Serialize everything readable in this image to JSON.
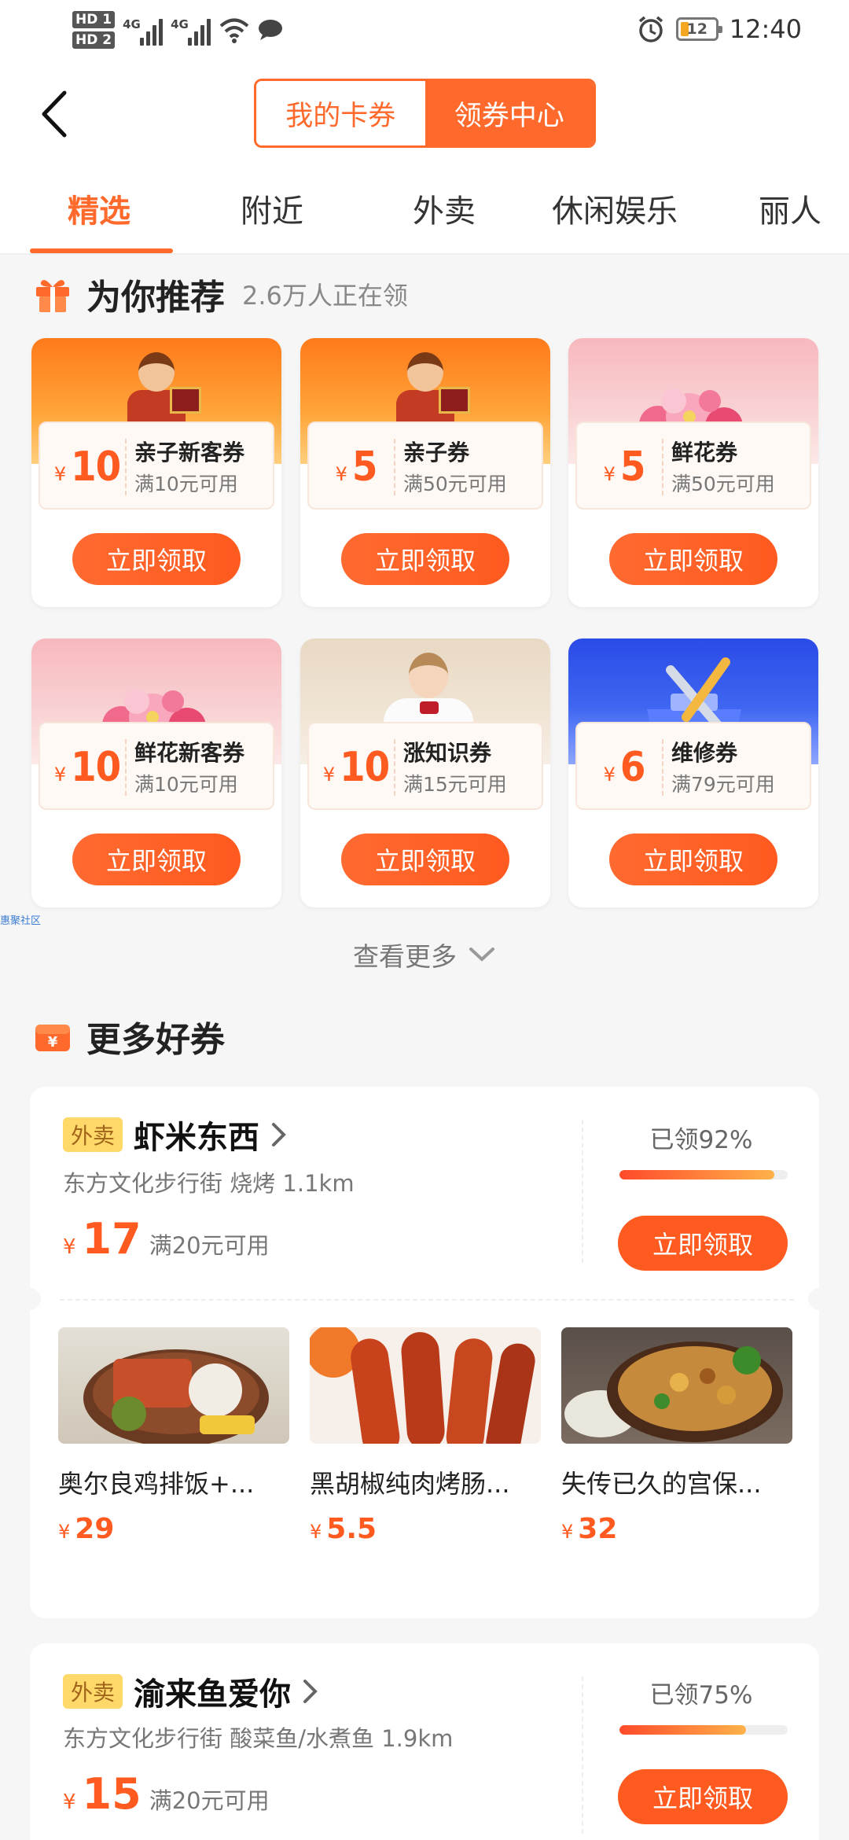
{
  "status_bar": {
    "hd1": "HD 1",
    "hd2": "HD 2",
    "net1": "4G",
    "net2": "4G",
    "battery": "12",
    "time": "12:40"
  },
  "header": {
    "seg_left": "我的卡券",
    "seg_right": "领券中心"
  },
  "tabs": [
    "精选",
    "附近",
    "外卖",
    "休闲娱乐",
    "丽人"
  ],
  "recommend": {
    "title": "为你推荐",
    "subtitle": "2.6万人正在领",
    "button_label": "立即领取",
    "cards": [
      {
        "currency": "¥",
        "amount": "10",
        "name": "亲子新客券",
        "condition": "满10元可用"
      },
      {
        "currency": "¥",
        "amount": "5",
        "name": "亲子券",
        "condition": "满50元可用"
      },
      {
        "currency": "¥",
        "amount": "5",
        "name": "鲜花券",
        "condition": "满50元可用"
      },
      {
        "currency": "¥",
        "amount": "10",
        "name": "鲜花新客券",
        "condition": "满10元可用"
      },
      {
        "currency": "¥",
        "amount": "10",
        "name": "涨知识券",
        "condition": "满15元可用"
      },
      {
        "currency": "¥",
        "amount": "6",
        "name": "维修券",
        "condition": "满79元可用"
      }
    ],
    "watermark": "惠聚社区",
    "see_more": "查看更多"
  },
  "more": {
    "title": "更多好券",
    "shops": [
      {
        "tag": "外卖",
        "name": "虾米东西",
        "meta": "东方文化步行街 烧烤 1.1km",
        "currency": "¥",
        "amount": "17",
        "condition": "满20元可用",
        "claimed_text": "已领92%",
        "claimed_pct": 92,
        "button": "立即领取",
        "dishes": [
          {
            "name": "奥尔良鸡排饭+...",
            "currency": "¥",
            "price": "29"
          },
          {
            "name": "黑胡椒纯肉烤肠...",
            "currency": "¥",
            "price": "5.5"
          },
          {
            "name": "失传已久的宫保...",
            "currency": "¥",
            "price": "32"
          }
        ]
      },
      {
        "tag": "外卖",
        "name": "渝来鱼爱你",
        "meta": "东方文化步行街 酸菜鱼/水煮鱼 1.9km",
        "currency": "¥",
        "amount": "15",
        "condition": "满20元可用",
        "claimed_text": "已领75%",
        "claimed_pct": 75,
        "button": "立即领取"
      }
    ]
  },
  "colors": {
    "accent": "#ff6a2c",
    "price": "#ff5a1f",
    "tag_bg": "#ffd86a"
  }
}
